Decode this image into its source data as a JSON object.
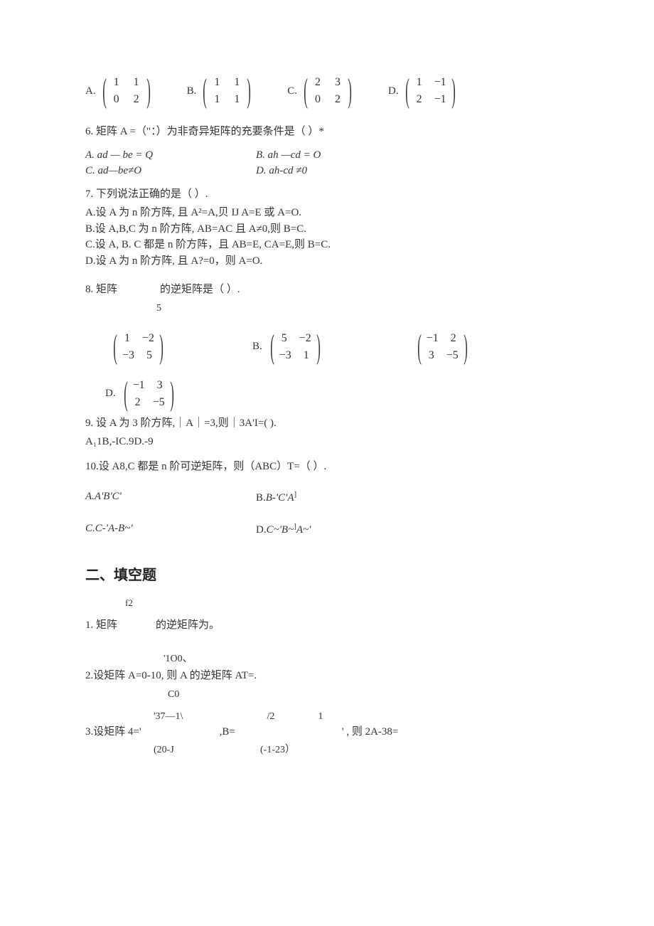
{
  "q5": {
    "A": {
      "label": "A.",
      "m": [
        [
          "1",
          "1"
        ],
        [
          "0",
          "2"
        ]
      ]
    },
    "B": {
      "label": "B.",
      "m": [
        [
          "1",
          "1"
        ],
        [
          "1",
          "1"
        ]
      ]
    },
    "C": {
      "label": "C.",
      "m": [
        [
          "2",
          "3"
        ],
        [
          "0",
          "2"
        ]
      ]
    },
    "D": {
      "label": "D.",
      "m": [
        [
          "1",
          "−1"
        ],
        [
          "2",
          "−1"
        ]
      ]
    }
  },
  "q6": {
    "stem": "6. 矩阵 A =（\"：）为非奇异矩阵的充要条件是（            ）*",
    "A": "A. ad — be = Q",
    "B": "B. ah —cd = O",
    "C": "C. ad—be≠O",
    "D": "D. ah-cd ≠0"
  },
  "q7": {
    "stem": "7. 下列说法正确的是（     ）.",
    "A": "A.设 A 为 n 阶方阵, 且 A²=A,贝 IJ A=E 或 A=O.",
    "B": "B.设  A,B,C 为  n 阶方阵, AB=AC 且  A≠0,则  B=C.",
    "C": "C.设 A, B. C 都是 n 阶方阵，且 AB=E, CA=E,则 B=C.",
    "D": "D.设 A 为 n 阶方阵, 且 A?=0，则 A=O."
  },
  "q8": {
    "stem1": "8. 矩阵",
    "stem2": "的逆矩阵是（          ）.",
    "below": "5",
    "A": {
      "label": "",
      "m": [
        [
          "1",
          "−2"
        ],
        [
          "−3",
          "5"
        ]
      ]
    },
    "B": {
      "label": "B.",
      "m": [
        [
          "5",
          "−2"
        ],
        [
          "−3",
          "1"
        ]
      ]
    },
    "C": {
      "label": "",
      "m": [
        [
          "−1",
          "2"
        ],
        [
          "3",
          "−5"
        ]
      ]
    },
    "D": {
      "label": "D.",
      "m": [
        [
          "−1",
          "3"
        ],
        [
          "2",
          "−5"
        ]
      ]
    }
  },
  "q9": {
    "stem": "9. 设 A 为 3 阶方阵,｜A｜=3,则｜3A'I=(        ).",
    "opts": "A₁1B,-IC.9D.-9"
  },
  "q10": {
    "stem": "10.设 A8,C 都是 n 阶可逆矩阵，则（ABC）T=（               ）.",
    "A": "A.A'B'C'",
    "B_pre": "B.",
    "B_it": "B-'C'A",
    "B_post": "]",
    "C": "C.C-'A-B~'",
    "D_pre": "D.",
    "D_it": "C~'B~",
    "D_mid": "]",
    "D_it2": "A~'"
  },
  "section2": "二、填空题",
  "f1": {
    "top": "f2",
    "pre": "1. 矩阵",
    "post": "的逆矩阵为。"
  },
  "f2": {
    "top": "'1O0、",
    "line": "2.设矩阵 A=0-10, 则 A 的逆矩阵 AT=.",
    "bottom": "C0"
  },
  "f3": {
    "toprow_a": "'37—1\\",
    "toprow_b": "/2",
    "toprow_c": "1",
    "line_pre": "3.设矩阵 4='",
    "line_mid": ",B=",
    "line_post": "' , 则 2A-38=",
    "botrow_a": "(20-J",
    "botrow_b": "(-1-23）"
  }
}
